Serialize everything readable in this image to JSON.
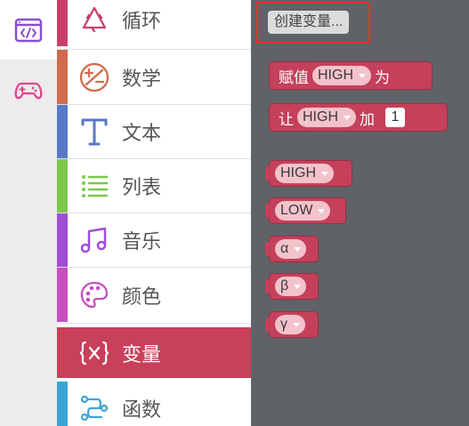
{
  "rail": {
    "items": [
      {
        "name": "code-editor-icon",
        "color": "#8a4fd1"
      },
      {
        "name": "gamepad-icon",
        "color": "#e0458f"
      }
    ]
  },
  "categories": [
    {
      "label": "循环",
      "color": "#c8406a",
      "icon": "loop-icon"
    },
    {
      "label": "数学",
      "color": "#d06b4c",
      "icon": "math-icon"
    },
    {
      "label": "文本",
      "color": "#5a78c8",
      "icon": "text-icon"
    },
    {
      "label": "列表",
      "color": "#7bc84a",
      "icon": "list-icon"
    },
    {
      "label": "音乐",
      "color": "#a24cd8",
      "icon": "music-icon"
    },
    {
      "label": "颜色",
      "color": "#c94fc0",
      "icon": "palette-icon"
    },
    {
      "label": "变量",
      "color": "#c8405a",
      "icon": "variable-icon",
      "selected": true
    },
    {
      "label": "函数",
      "color": "#3ba6d6",
      "icon": "function-icon"
    }
  ],
  "workspace": {
    "create_button": "创建变量...",
    "blocks": {
      "set": {
        "keyword": "赋值",
        "var": "HIGH",
        "suffix": "为"
      },
      "change": {
        "keyword": "让",
        "var": "HIGH",
        "op": "加",
        "value": "1"
      },
      "vars": [
        "HIGH",
        "LOW",
        "α",
        "β",
        "γ"
      ]
    },
    "colors": {
      "block": "#c5405a",
      "background": "#5f6266",
      "highlight": "#e0332b"
    }
  }
}
